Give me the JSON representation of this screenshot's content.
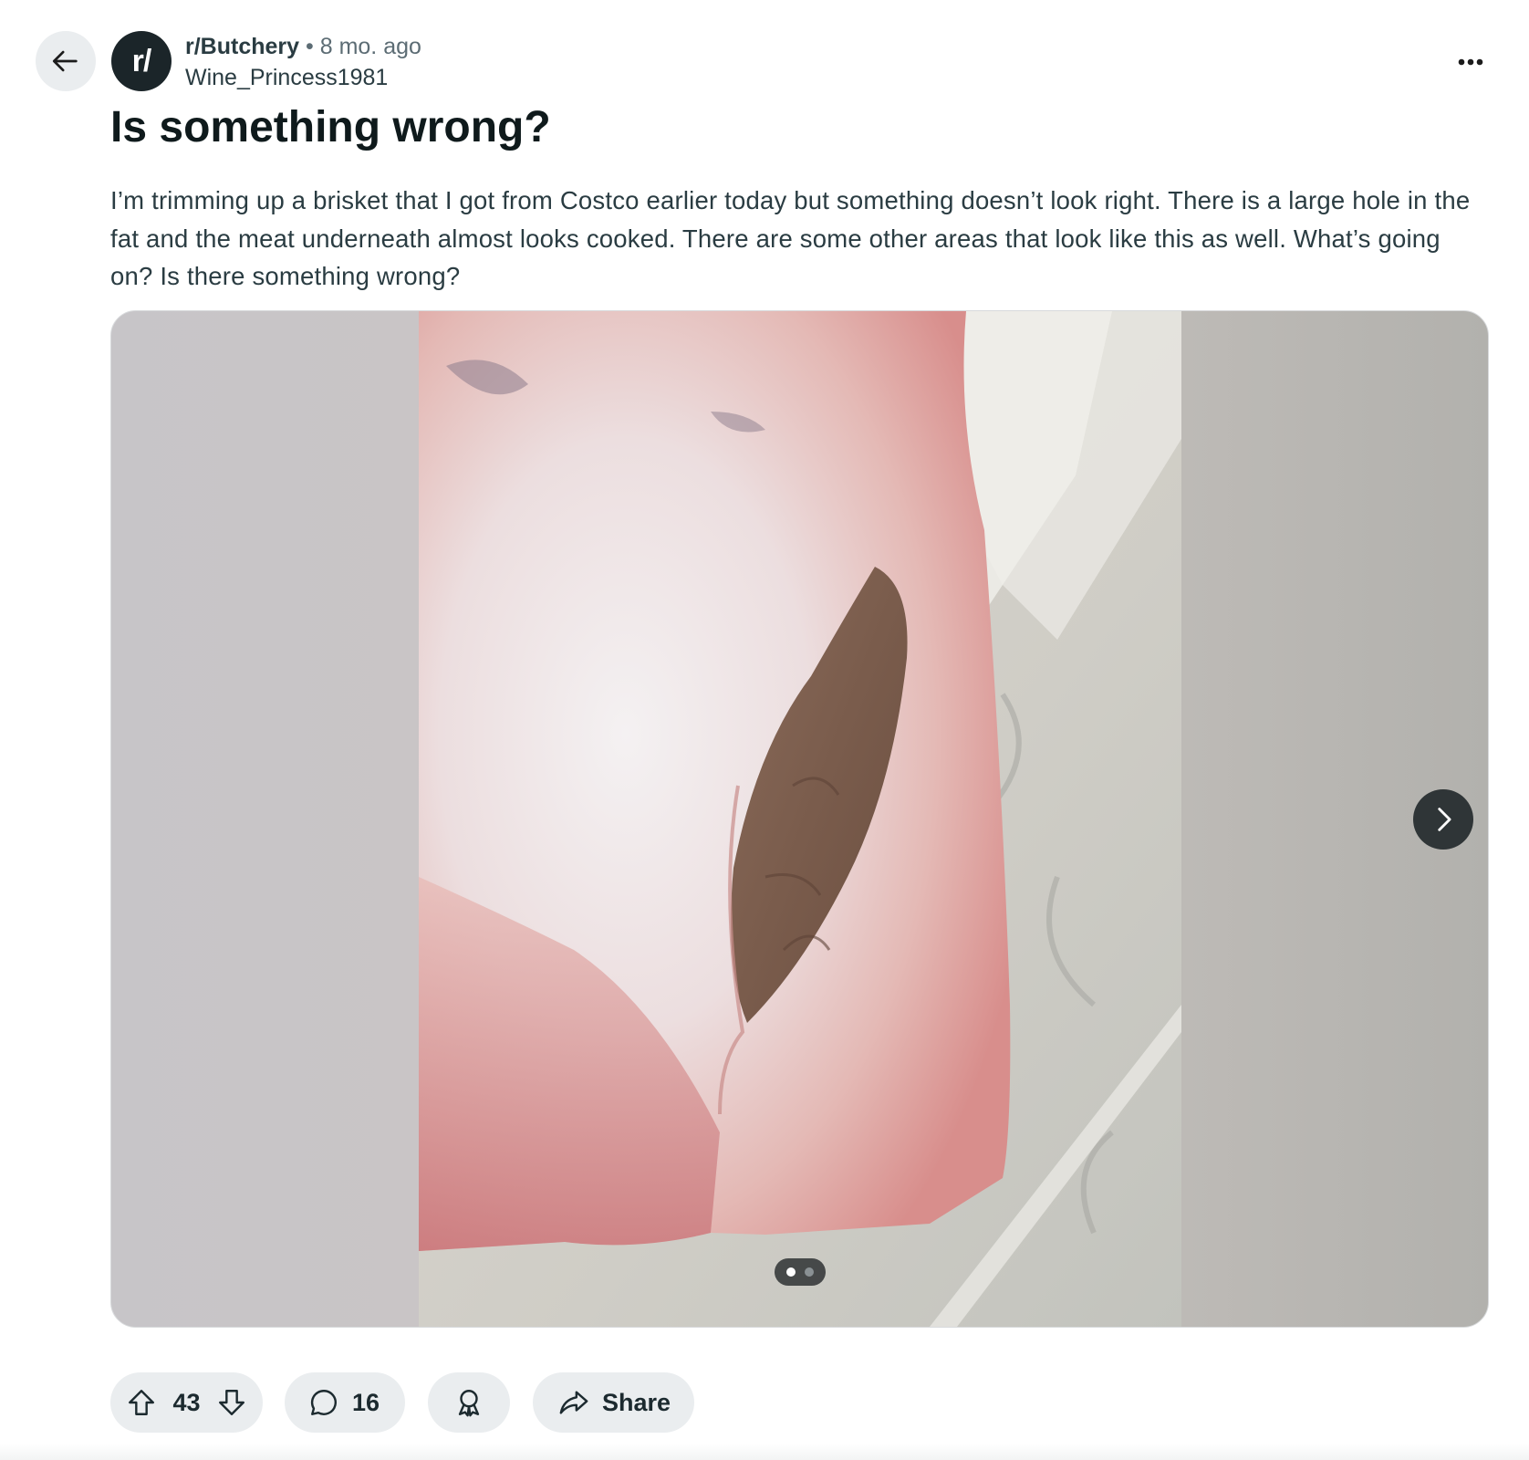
{
  "post": {
    "subreddit": "r/Butchery",
    "separator": "•",
    "time_ago": "8 mo. ago",
    "author": "Wine_Princess1981",
    "avatar_text": "r/",
    "title": "Is something wrong?",
    "body": "I’m trimming up a brisket that I got from Costco earlier today but something doesn’t look right. There is a large hole in the fat and the meat underneath almost looks cooked. There are some other areas that look like this as well. What’s going on? Is there something wrong?"
  },
  "gallery": {
    "total_images": 2,
    "current_index": 1
  },
  "actions": {
    "upvotes": "43",
    "comments": "16",
    "share_label": "Share"
  },
  "icons": {
    "back": "arrow-left-icon",
    "more": "more-horizontal-icon",
    "next": "chevron-right-icon",
    "upvote": "upvote-arrow-icon",
    "downvote": "downvote-arrow-icon",
    "comment": "speech-bubble-icon",
    "award": "award-ribbon-icon",
    "share": "share-arrow-icon"
  },
  "colors": {
    "avatar_bg": "#1b2529",
    "pill_bg": "#eaedef",
    "title_text": "#0f1a1c",
    "body_text": "#2a3c42",
    "muted_text": "#5c6c74"
  }
}
